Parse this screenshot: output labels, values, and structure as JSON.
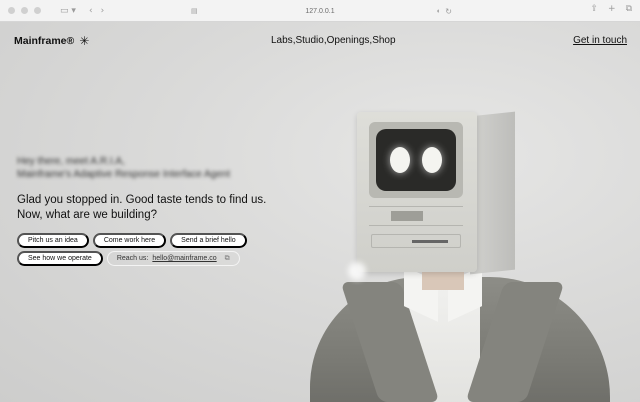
{
  "browser": {
    "url": "127.0.0.1",
    "icons": {
      "sidebar": "sidebar-icon",
      "back": "chevron-left-icon",
      "forward": "chevron-right-icon",
      "reader": "reader-icon",
      "reload": "reload-icon",
      "share": "share-icon",
      "new_tab": "plus-icon",
      "tabs": "tabs-icon"
    }
  },
  "header": {
    "brand": "Mainframe®",
    "brand_icon": "asterisk-icon",
    "nav": [
      "Labs",
      "Studio",
      "Openings",
      "Shop"
    ],
    "nav_separator": ",",
    "cta": "Get in touch"
  },
  "hero": {
    "intro_line1": "Hey there, meet A.R.I.A,",
    "intro_line2": "Mainframe's Adaptive Response Interface Agent",
    "headline": "Glad you stopped in. Good taste tends to find us. Now, what are we building?",
    "actions": [
      "Pitch us an idea",
      "Come work here",
      "Send a brief hello",
      "See how we operate"
    ],
    "contact_prefix": "Reach us:",
    "contact_email": "hello@mainframe.co",
    "contact_icon": "copy-icon"
  },
  "colors": {
    "background": "#dadad9",
    "text": "#111111",
    "pill": "#ffffff"
  }
}
